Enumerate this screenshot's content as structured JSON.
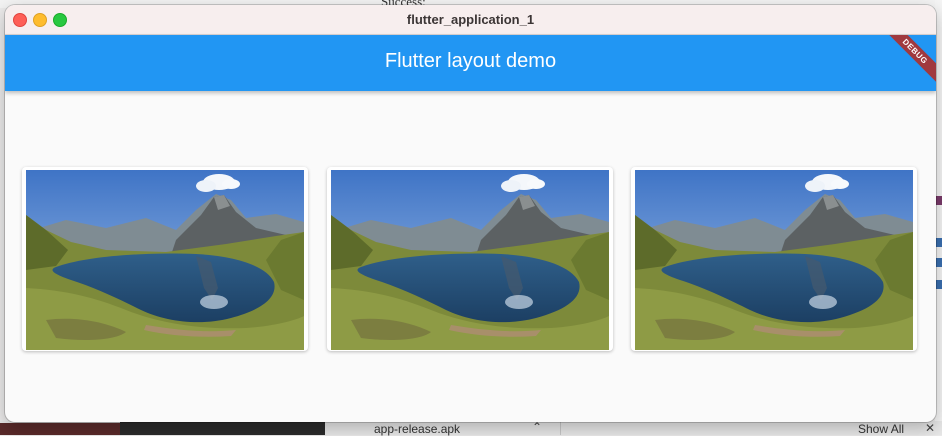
{
  "background": {
    "top_snippet": "Success:",
    "download_file": "app-release.apk",
    "show_all_label": "Show All"
  },
  "window": {
    "title": "flutter_application_1"
  },
  "app": {
    "appbar_title": "Flutter layout demo",
    "debug_banner": "DEBUG",
    "primary_color": "#2196f3"
  },
  "cards": [
    {
      "image": "mountain-lake-photo"
    },
    {
      "image": "mountain-lake-photo"
    },
    {
      "image": "mountain-lake-photo"
    }
  ]
}
